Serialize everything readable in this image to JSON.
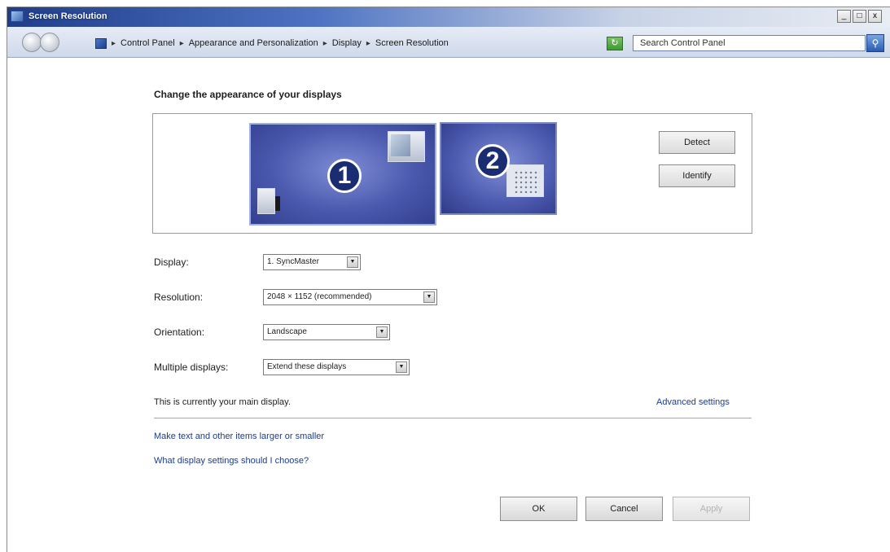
{
  "window": {
    "title": "Screen Resolution",
    "controls": [
      "_",
      "□",
      "x"
    ]
  },
  "address_bar": {
    "breadcrumbs": [
      "Control Panel",
      "Appearance and Personalization",
      "Display",
      "Screen Resolution"
    ],
    "search_placeholder": "Search Control Panel"
  },
  "main": {
    "heading": "Change the appearance of your displays",
    "monitors": [
      {
        "number": "1",
        "selected": true
      },
      {
        "number": "2",
        "selected": false
      }
    ],
    "detect_label": "Detect",
    "identify_label": "Identify",
    "fields": {
      "display": {
        "label": "Display:",
        "value": "1. SyncMaster"
      },
      "resolution": {
        "label": "Resolution:",
        "value": "2048 × 1152 (recommended)"
      },
      "orientation": {
        "label": "Orientation:",
        "value": "Landscape"
      },
      "multiple": {
        "label": "Multiple displays:",
        "value": "Extend these displays"
      }
    },
    "main_display_text": "This is currently your main display.",
    "advanced_link": "Advanced settings",
    "link_text_size": "Make text and other items larger or smaller",
    "link_help": "What display settings should I choose?"
  },
  "buttons": {
    "ok": "OK",
    "cancel": "Cancel",
    "apply": "Apply"
  },
  "colors": {
    "title_bar": "#1f3d8a",
    "monitor_fill": "#4a58ad",
    "link": "#1c3c8c"
  }
}
